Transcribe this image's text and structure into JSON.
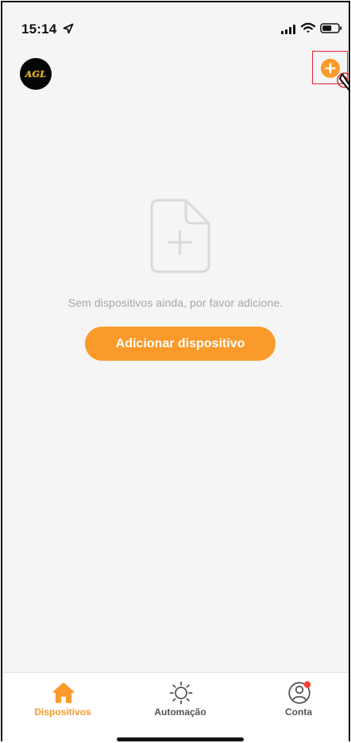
{
  "status_bar": {
    "time": "15:14",
    "location_icon": "location-arrow-icon",
    "signal_icon": "cellular-signal-icon",
    "wifi_icon": "wifi-icon",
    "battery_icon": "battery-icon"
  },
  "header": {
    "logo_text": "AGL",
    "add_icon": "plus-circle-icon",
    "accent": "#f99a2a",
    "highlight_color": "#e3262f"
  },
  "empty_state": {
    "icon": "file-plus-icon",
    "message": "Sem dispositivos ainda, por favor adicione.",
    "button_label": "Adicionar dispositivo"
  },
  "tabs": [
    {
      "label": "Dispositivos",
      "icon": "home-icon",
      "active": true
    },
    {
      "label": "Automação",
      "icon": "sun-icon",
      "active": false
    },
    {
      "label": "Conta",
      "icon": "user-circle-icon",
      "active": false,
      "notification_dot": true
    }
  ],
  "colors": {
    "background": "#f5f5f5",
    "muted_text": "#a6a6a6",
    "tab_text": "#555555",
    "notification": "#ff3b30"
  }
}
